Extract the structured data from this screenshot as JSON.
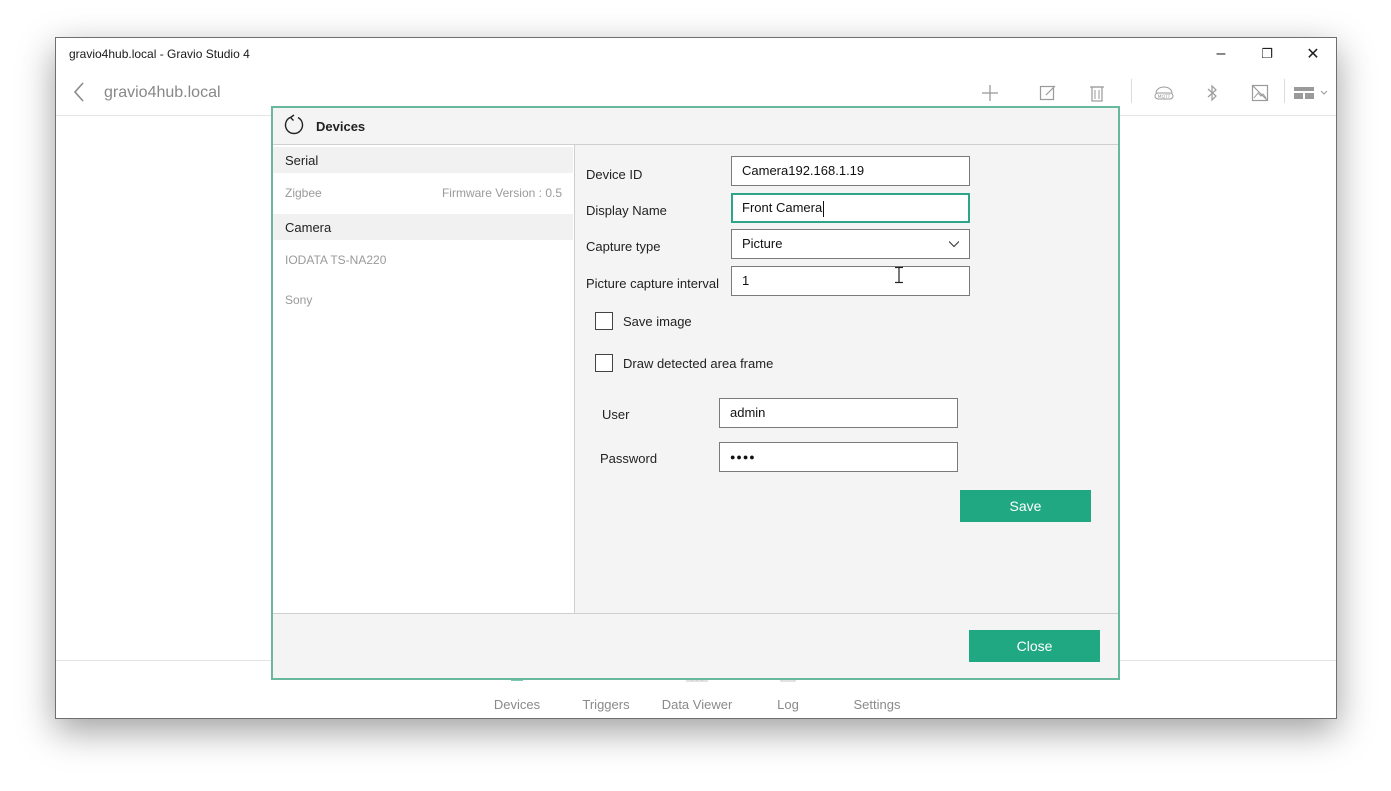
{
  "window": {
    "title": "gravio4hub.local - Gravio Studio 4",
    "controls": {
      "minimize": "–",
      "restore": "❐",
      "close": "✕"
    }
  },
  "appbar": {
    "host": "gravio4hub.local",
    "icons": [
      "back-icon",
      "add-icon",
      "edit-icon",
      "delete-icon",
      "mqtt-icon",
      "bluetooth-icon",
      "no-image-icon",
      "layout-icon"
    ]
  },
  "bottom_nav": {
    "items": [
      {
        "label": "Devices"
      },
      {
        "label": "Triggers"
      },
      {
        "label": "Data Viewer"
      },
      {
        "label": "Log"
      },
      {
        "label": "Settings"
      }
    ]
  },
  "dialog": {
    "title": "Devices",
    "groups": {
      "serial": {
        "label": "Serial",
        "items": [
          {
            "name": "Zigbee",
            "firmware": "Firmware Version : 0.5"
          }
        ]
      },
      "camera": {
        "label": "Camera",
        "items": [
          {
            "name": "IODATA TS-NA220"
          },
          {
            "name": "Sony"
          }
        ]
      }
    },
    "form": {
      "device_id": {
        "label": "Device ID",
        "value": "Camera192.168.1.19"
      },
      "display_name": {
        "label": "Display Name",
        "value": "Front Camera"
      },
      "capture_type": {
        "label": "Capture type",
        "value": "Picture"
      },
      "picture_capture_interval": {
        "label": "Picture capture interval",
        "value": "1"
      },
      "save_image": {
        "label": "Save image",
        "checked": false
      },
      "draw_frame": {
        "label": "Draw detected area frame",
        "checked": false
      },
      "user": {
        "label": "User",
        "value": "admin"
      },
      "password": {
        "label": "Password",
        "value": "●●●●"
      },
      "save_label": "Save"
    },
    "close_label": "Close"
  },
  "colors": {
    "accent": "#20a883",
    "dialog_border": "#68b89c"
  }
}
